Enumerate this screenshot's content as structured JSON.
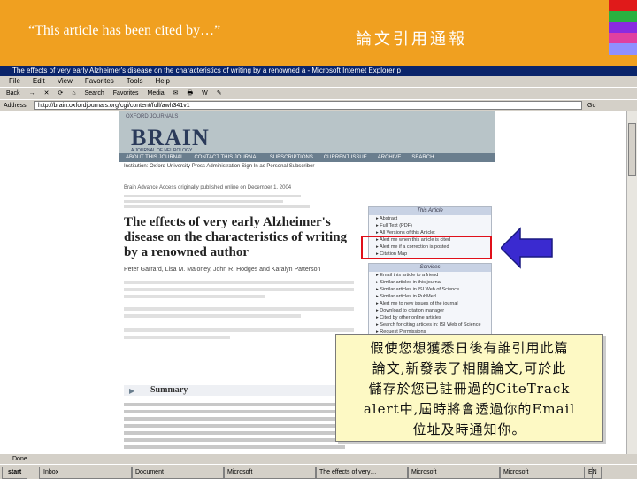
{
  "slide": {
    "quote": "“This article has been cited by…”",
    "title": "論文引用通報",
    "strip_colors": [
      "#e01a1a",
      "#2ab040",
      "#8a2ae0",
      "#e040a0",
      "#9090ff",
      "#f0a020"
    ],
    "header_color": "#f0a020"
  },
  "browser": {
    "window_title": "The effects of very early Alzheimer's disease on the characteristics of writing by a renowned a - Microsoft Internet Explorer p",
    "menu": [
      "File",
      "Edit",
      "View",
      "Favorites",
      "Tools",
      "Help"
    ],
    "toolbar": [
      "Back",
      "→",
      "✕",
      "⟳",
      "⌂",
      "Search",
      "Favorites",
      "Media",
      "✉",
      "🖶",
      "W",
      "✎"
    ],
    "address_label": "Address",
    "address_value": "http://brain.oxfordjournals.org/cgi/content/full/awh341v1",
    "go_label": "Go",
    "status_text": "Done",
    "start_label": "start",
    "taskbar_items": [
      "Inbox",
      "Document",
      "Microsoft",
      "The effects of very…",
      "Microsoft",
      "Microsoft"
    ],
    "tray_text": "EN"
  },
  "journal": {
    "publisher": "OXFORD JOURNALS",
    "name": "BRAIN",
    "subtitle": "A JOURNAL OF NEUROLOGY",
    "nav": [
      "ABOUT THIS JOURNAL",
      "CONTACT THIS JOURNAL",
      "SUBSCRIPTIONS",
      "CURRENT ISSUE",
      "ARCHIVE",
      "SEARCH"
    ],
    "institution_line": "Institution: Oxford University Press Administration  Sign In as Personal Subscriber",
    "advance_line": "Brain Advance Access originally published online on December 1, 2004",
    "article_title": "The effects of very early Alzheimer's disease on the characteristics of writing by a renowned author",
    "authors": "Peter Garrard, Lisa M. Maloney, John R. Hodges and Karalyn Patterson",
    "this_article_head": "This Article",
    "this_article_items": [
      "Abstract",
      "Full Text (PDF)",
      "All Versions of this Article:",
      "Alert me when this article is cited",
      "Alert me if a correction is posted",
      "Citation Map"
    ],
    "services_head": "Services",
    "services_items": [
      "Email this article to a friend",
      "Similar articles in this journal",
      "Similar articles in ISI Web of Science",
      "Similar articles in PubMed",
      "Alert me to new issues of the journal",
      "Download to citation manager",
      "Cited by other online articles",
      "Search for citing articles in: ISI Web of Science",
      "Request Permissions"
    ],
    "summary_label": "Summary"
  },
  "callout": {
    "lines": [
      "假使您想獲悉日後有誰引用此篇",
      "論文,新發表了相關論文,可於此",
      "儲存於您已註冊過的CiteTrack",
      "alert中,屆時將會透過你的Email",
      "位址及時通知你。"
    ]
  },
  "annotation": {
    "highlight_color": "#e0101a",
    "arrow_color": "#3a2ad0"
  }
}
